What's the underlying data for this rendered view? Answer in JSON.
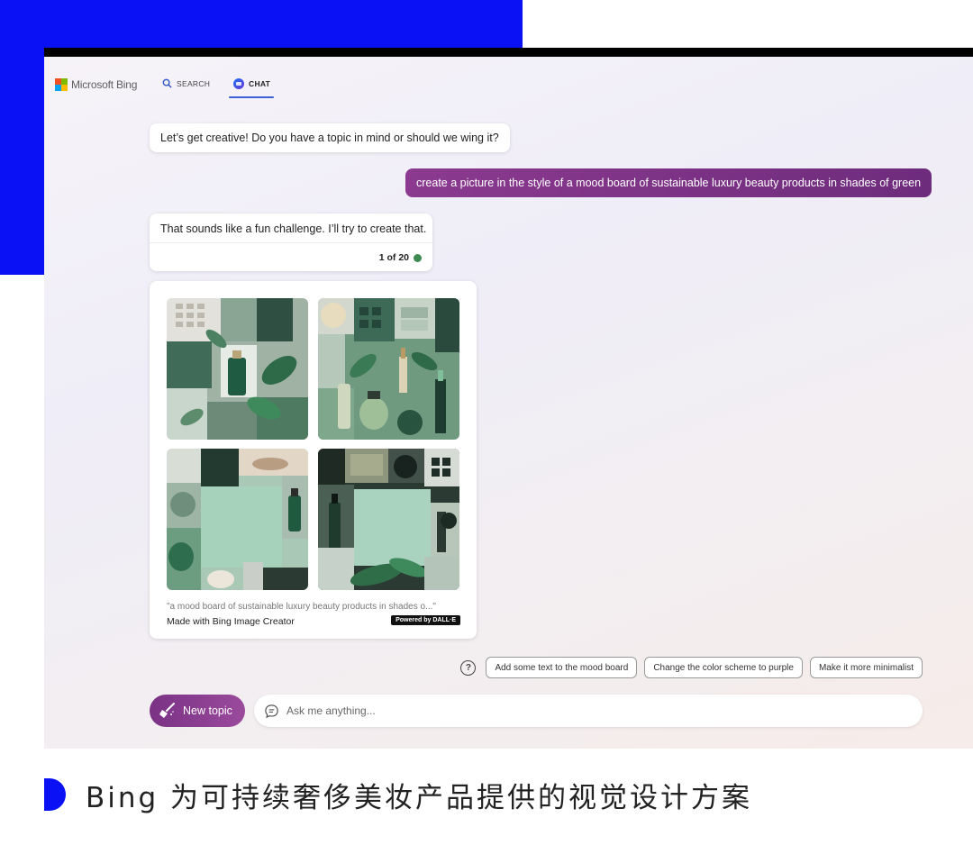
{
  "header": {
    "logo_text": "Microsoft Bing",
    "nav": [
      {
        "label": "SEARCH",
        "icon": "search-icon"
      },
      {
        "label": "CHAT",
        "icon": "chat-icon",
        "active": true
      }
    ]
  },
  "chat": {
    "bot_greeting": "Let’s get creative! Do you have a topic in mind or should we wing it?",
    "user_prompt": "create a picture in the style of a mood board of sustainable luxury beauty products in shades of green",
    "bot_reply": "That sounds like a fun challenge. I’ll try to create that.",
    "reply_counter": "1 of 20",
    "image_card": {
      "caption": "\"a mood board of sustainable luxury beauty products in shades o...\"",
      "made_with": "Made with Bing Image Creator",
      "badge": "Powered by DALL·E"
    }
  },
  "suggestions": [
    "Add some text to the mood board",
    "Change the color scheme to purple",
    "Make it more minimalist"
  ],
  "composer": {
    "new_topic_label": "New topic",
    "placeholder": "Ask me anything..."
  },
  "page_caption": "Bing 为可持续奢侈美妆产品提供的视觉设计方案",
  "colors": {
    "accent_blue": "#0a12f5",
    "user_bubble": "#8b3a8f",
    "new_topic": "#7a3285"
  }
}
